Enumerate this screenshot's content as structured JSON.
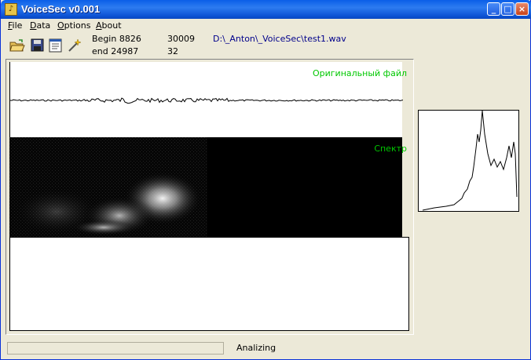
{
  "window": {
    "title": "VoiceSec v0.001"
  },
  "title_buttons": {
    "minimize": "_",
    "maximize": "□",
    "close": "×"
  },
  "menu": [
    {
      "label": "File",
      "mnemonic": "F",
      "rest": "ile"
    },
    {
      "label": "Data",
      "mnemonic": "D",
      "rest": "ata"
    },
    {
      "label": "Options",
      "mnemonic": "O",
      "rest": "ptions"
    },
    {
      "label": "About",
      "mnemonic": "A",
      "rest": "bout"
    }
  ],
  "toolbar": {
    "icons": [
      "open-folder-icon",
      "save-icon",
      "properties-icon",
      "wand-icon"
    ],
    "begin_label": "Begin 8826",
    "begin_value2": "30009",
    "end_label": "end  24987",
    "end_value2": "32",
    "file_path": "D:\\_Anton\\_VoiceSec\\test1.wav"
  },
  "waveform": {
    "label": "Оригинальный файл"
  },
  "spectrogram": {
    "label": "Спектр"
  },
  "status": {
    "text": "Analizing",
    "progress": 0
  },
  "colors": {
    "label_green": "#00c800",
    "path_blue": "#00008b",
    "titlebar": "#0a5fe8"
  }
}
